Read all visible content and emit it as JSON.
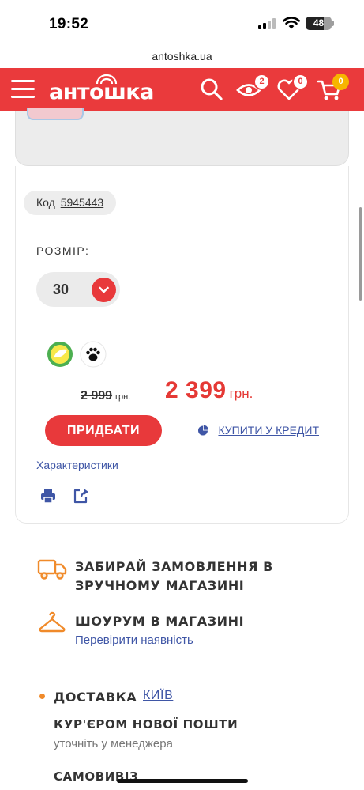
{
  "status_bar": {
    "time": "19:52",
    "battery": "48"
  },
  "browser": {
    "url": "antoshka.ua"
  },
  "header": {
    "logo": "антошка",
    "viewed_count": "2",
    "wishlist_count": "0",
    "cart_count": "0"
  },
  "product": {
    "code_label": "Код",
    "code_value": "5945443",
    "size_label": "РОЗМІР:",
    "size_value": "30",
    "old_price": "2 999",
    "old_price_currency": "грн.",
    "new_price": "2 399",
    "new_price_currency": "грн.",
    "buy_label": "ПРИДБАТИ",
    "credit_label": "КУПИТИ У КРЕДИТ",
    "characteristics_label": "Характеристики"
  },
  "info": {
    "pickup_line1": "ЗАБИРАЙ ЗАМОВЛЕННЯ В",
    "pickup_line2": "ЗРУЧНОМУ МАГАЗИНІ",
    "showroom_title": "ШОУРУМ В МАГАЗИНІ",
    "showroom_link": "Перевірити наявність",
    "delivery_title": "ДОСТАВКА",
    "delivery_city": "КИЇВ",
    "courier_title": "КУР'ЄРОМ НОВОЇ ПОШТИ",
    "courier_note": "уточніть у менеджера",
    "pickup_title": "САМОВИВІЗ"
  },
  "colors": {
    "brand_red": "#ea3a3c",
    "price_red": "#e53935",
    "link_blue": "#3f56a6",
    "accent_orange": "#f08a2a",
    "badge_yellow": "#f7b500",
    "info_bg": "#fdeedd"
  },
  "icons": [
    "menu-icon",
    "search-icon",
    "eye-icon",
    "heart-icon",
    "cart-icon",
    "chevron-down-icon",
    "eco-leaf-icon",
    "paw-icon",
    "pie-chart-icon",
    "print-icon",
    "share-icon",
    "truck-icon",
    "hanger-icon"
  ]
}
